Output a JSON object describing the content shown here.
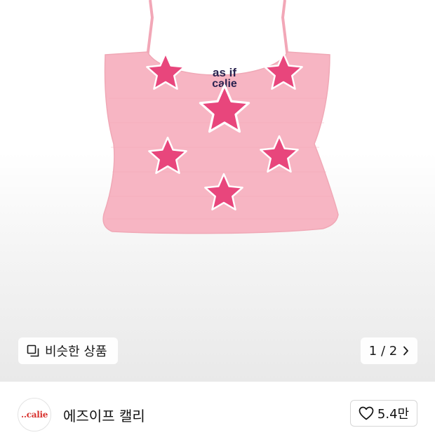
{
  "product": {
    "print_text_line1": "as if",
    "print_text_line2": "calie",
    "colors": {
      "top": "#f7b5c3",
      "star": "#e8467c",
      "print_text": "#2b2350"
    }
  },
  "similar_products": {
    "label": "비슷한 상품",
    "icon": "similar-products-icon"
  },
  "pager": {
    "text": "1 / 2",
    "icon": "chevron-right-icon"
  },
  "brand": {
    "name": "에즈이프 캘리",
    "logo_text": "..calie",
    "likes": "5.4만",
    "like_icon": "heart-outline-icon"
  }
}
